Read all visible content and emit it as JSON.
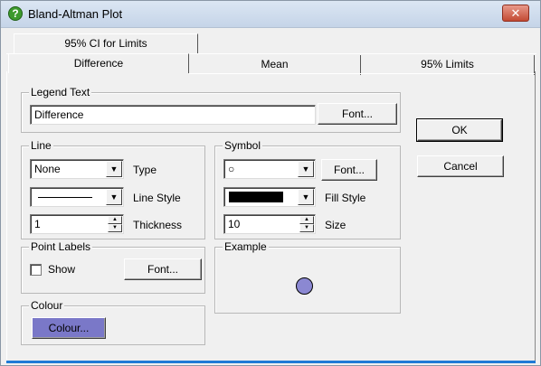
{
  "window": {
    "title": "Bland-Altman Plot",
    "close_glyph": "✕"
  },
  "tabs": {
    "back": {
      "label": "95% CI for Limits",
      "mnemonic": "9"
    },
    "front": [
      {
        "label": "Difference",
        "mnemonic": "D"
      },
      {
        "label": "Mean",
        "mnemonic": "M"
      },
      {
        "label": "95% Limits",
        "mnemonic": "9"
      }
    ]
  },
  "legend": {
    "group_label": "Legend Text",
    "value": "Difference",
    "font_button": "Font..."
  },
  "line": {
    "group_label": "Line",
    "type_value": "None",
    "type_label": "Type",
    "style_label": "Line Style",
    "thickness_value": "1",
    "thickness_label": "Thickness"
  },
  "symbol": {
    "group_label": "Symbol",
    "symbol_value": "○",
    "font_button": "Font...",
    "fill_label": "Fill Style",
    "size_value": "10",
    "size_label": "Size"
  },
  "point_labels": {
    "group_label": "Point Labels",
    "show_label": "Show",
    "show_checked": false,
    "font_button": "Font..."
  },
  "colour": {
    "group_label": "Colour",
    "button": "Colour...",
    "swatch_color": "#7a78c8"
  },
  "example": {
    "group_label": "Example",
    "marker_fill": "#8b88d2"
  },
  "actions": {
    "ok": "OK",
    "cancel": "Cancel"
  }
}
